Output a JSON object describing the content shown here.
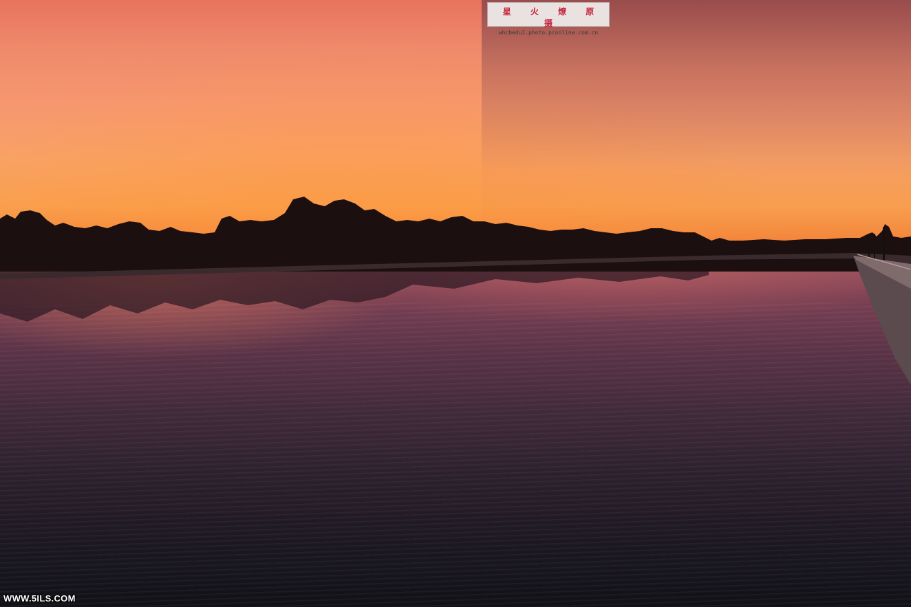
{
  "photo": {
    "subject": "sunset-river-with-treeline",
    "colors": {
      "sky_top": "#e8735e",
      "sky_horizon": "#f4883c",
      "tree_silhouette": "#1c0f10",
      "water_light": "#9a5360",
      "water_dark": "#121117"
    }
  },
  "watermarks": {
    "top": {
      "title": "星 火 燎 原 摄",
      "url": "whcbedu1.photo.pconline.com.cn"
    },
    "bottom": {
      "text": "WWW.5ILS.COM"
    }
  }
}
